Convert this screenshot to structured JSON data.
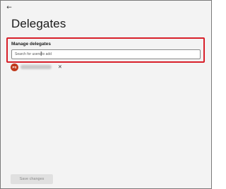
{
  "header": {
    "back_glyph": "←",
    "title": "Delegates"
  },
  "manage": {
    "label": "Manage delegates",
    "search_placeholder": "Search for users to add",
    "search_value": ""
  },
  "delegates": [
    {
      "initials": "PS",
      "remove_glyph": "✕",
      "avatar_color": "#c0391b"
    }
  ],
  "footer": {
    "save_label": "Save changes"
  },
  "colors": {
    "highlight": "#d8202a",
    "window_bg": "#f3f3f3"
  }
}
